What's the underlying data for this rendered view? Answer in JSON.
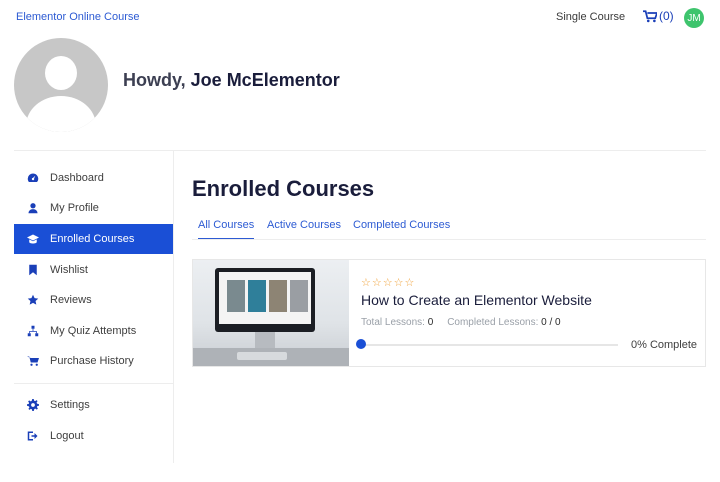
{
  "header": {
    "site_title": "Elementor Online Course",
    "nav_link": "Single Course",
    "cart_count": "(0)",
    "user_initials": "JM",
    "avatar_color": "#3ec46d"
  },
  "hero": {
    "greeting": "Howdy, ",
    "user_name": "Joe McElementor"
  },
  "sidebar": {
    "items": [
      {
        "label": "Dashboard",
        "icon": "dashboard-icon"
      },
      {
        "label": "My Profile",
        "icon": "user-icon"
      },
      {
        "label": "Enrolled Courses",
        "icon": "graduation-cap-icon",
        "active": true
      },
      {
        "label": "Wishlist",
        "icon": "bookmark-icon"
      },
      {
        "label": "Reviews",
        "icon": "star-icon"
      },
      {
        "label": "My Quiz Attempts",
        "icon": "sitemap-icon"
      },
      {
        "label": "Purchase History",
        "icon": "cart-icon"
      },
      {
        "label": "Settings",
        "icon": "gear-icon"
      },
      {
        "label": "Logout",
        "icon": "logout-icon"
      }
    ]
  },
  "main": {
    "title": "Enrolled Courses",
    "tabs": [
      {
        "label": "All Courses",
        "active": true
      },
      {
        "label": "Active Courses"
      },
      {
        "label": "Completed Courses"
      }
    ],
    "course": {
      "rating_stars": "☆☆☆☆☆",
      "title": "How to Create an Elementor Website",
      "total_lessons_label": "Total Lessons:",
      "total_lessons_value": "0",
      "completed_lessons_label": "Completed Lessons:",
      "completed_lessons_value": "0 / 0",
      "progress_percent": 0,
      "progress_label": "0% Complete"
    }
  },
  "colors": {
    "accent": "#1a4fd6",
    "link": "#2d5bd3",
    "star": "#f0a23a"
  }
}
